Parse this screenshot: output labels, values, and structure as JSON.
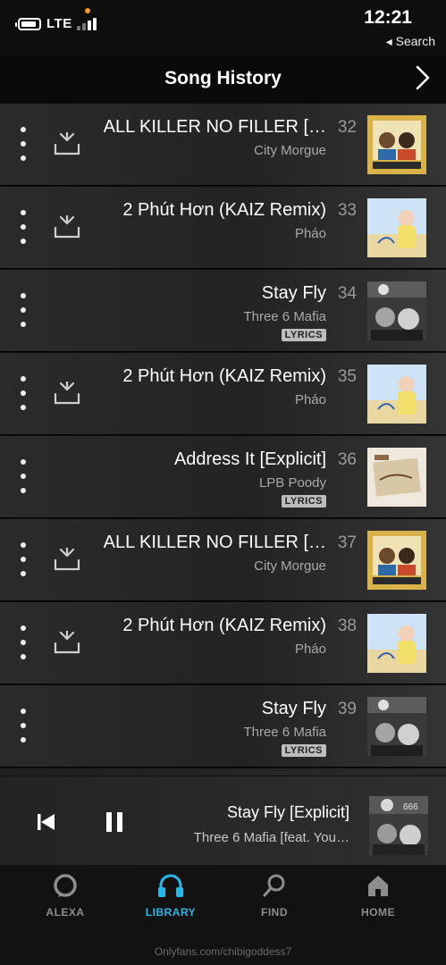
{
  "status_bar": {
    "time": "12:21",
    "network": "LTE",
    "back_label": "◂ Search"
  },
  "header": {
    "title": "Song History"
  },
  "tracks": [
    {
      "number": "32",
      "title": "ALL KILLER NO FILLER […",
      "artist": "City Morgue",
      "lyrics": "",
      "art": "city-morgue-art"
    },
    {
      "number": "33",
      "title": "2 Phút Hơn (KAIZ Remix)",
      "artist": "Pháo",
      "lyrics": "",
      "art": "phao-art"
    },
    {
      "number": "34",
      "title": "Stay Fly",
      "artist": "Three 6 Mafia",
      "lyrics": "LYRICS",
      "art": "three-6-mafia-art"
    },
    {
      "number": "35",
      "title": "2 Phút Hơn (KAIZ Remix)",
      "artist": "Pháo",
      "lyrics": "",
      "art": "phao-art"
    },
    {
      "number": "36",
      "title": "Address It [Explicit]",
      "artist": "LPB Poody",
      "lyrics": "LYRICS",
      "art": "lpb-poody-art"
    },
    {
      "number": "37",
      "title": "ALL KILLER NO FILLER […",
      "artist": "City Morgue",
      "lyrics": "",
      "art": "city-morgue-art"
    },
    {
      "number": "38",
      "title": "2 Phút Hơn (KAIZ Remix)",
      "artist": "Pháo",
      "lyrics": "",
      "art": "phao-art"
    },
    {
      "number": "39",
      "title": "Stay Fly",
      "artist": "Three 6 Mafia",
      "lyrics": "LYRICS",
      "art": "three-6-mafia-art"
    }
  ],
  "now_playing": {
    "title": "Stay Fly [Explicit]",
    "artist": "Three 6 Mafia [feat. You…"
  },
  "nav": {
    "home": "HOME",
    "find": "FIND",
    "library": "LIBRARY",
    "alexa": "ALEXA",
    "active": "library"
  },
  "watermark": "Onlyfans.com/chibigoddess7",
  "colors": {
    "accent": "#29b6e8",
    "background": "#0e0e0e",
    "row": "#2b2b2b",
    "status_dot": "#f29b2c"
  },
  "icons": [
    "more-options-icon",
    "download-icon",
    "previous-icon",
    "pause-icon",
    "home-icon",
    "search-icon",
    "headphones-icon",
    "alexa-icon",
    "chevron-right-icon"
  ]
}
